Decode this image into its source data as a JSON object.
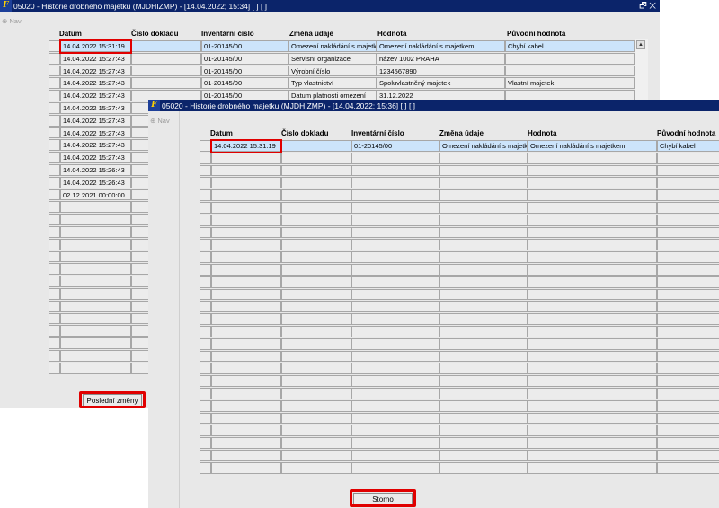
{
  "window1": {
    "title": "05020 - Historie drobného majetku (MJDHIZMP) - [14.04.2022; 15:34]  [ ]  [ ]",
    "window_controls": "🗗 ✕",
    "nav_label": "Nav",
    "headers": [
      "Datum",
      "Číslo dokladu",
      "Inventární číslo",
      "Změna údaje",
      "Hodnota",
      "Původní hodnota"
    ],
    "rows": [
      [
        "14.04.2022 15:31:19",
        "",
        "01-20145/00",
        "Omezení nakládání s majetk",
        "Omezení nakládání s majetkem",
        "Chybí kabel"
      ],
      [
        "14.04.2022 15:27:43",
        "",
        "01-20145/00",
        "Servisní organizace",
        "název 1002  PRAHA",
        ""
      ],
      [
        "14.04.2022 15:27:43",
        "",
        "01-20145/00",
        "Výrobní číslo",
        "1234567890",
        ""
      ],
      [
        "14.04.2022 15:27:43",
        "",
        "01-20145/00",
        "Typ vlastnictví",
        "Spoluvlastněný majetek",
        "Vlastní majetek"
      ],
      [
        "14.04.2022 15:27:43",
        "",
        "01-20145/00",
        "Datum platnosti omezení",
        "31.12.2022",
        ""
      ],
      [
        "14.04.2022 15:27:43",
        "",
        "",
        "",
        "",
        ""
      ],
      [
        "14.04.2022 15:27:43",
        "",
        "",
        "",
        "",
        ""
      ],
      [
        "14.04.2022 15:27:43",
        "",
        "",
        "",
        "",
        ""
      ],
      [
        "14.04.2022 15:27:43",
        "",
        "",
        "",
        "",
        ""
      ],
      [
        "14.04.2022 15:27:43",
        "",
        "",
        "",
        "",
        ""
      ],
      [
        "14.04.2022 15:26:43",
        "",
        "",
        "",
        "",
        ""
      ],
      [
        "14.04.2022 15:26:43",
        "",
        "",
        "",
        "",
        ""
      ],
      [
        "02.12.2021 00:00:00",
        "",
        "",
        "",
        "",
        ""
      ],
      [
        "",
        "",
        "",
        "",
        "",
        ""
      ],
      [
        "",
        "",
        "",
        "",
        "",
        ""
      ],
      [
        "",
        "",
        "",
        "",
        "",
        ""
      ],
      [
        "",
        "",
        "",
        "",
        "",
        ""
      ],
      [
        "",
        "",
        "",
        "",
        "",
        ""
      ],
      [
        "",
        "",
        "",
        "",
        "",
        ""
      ],
      [
        "",
        "",
        "",
        "",
        "",
        ""
      ],
      [
        "",
        "",
        "",
        "",
        "",
        ""
      ],
      [
        "",
        "",
        "",
        "",
        "",
        ""
      ],
      [
        "",
        "",
        "",
        "",
        "",
        ""
      ],
      [
        "",
        "",
        "",
        "",
        "",
        ""
      ],
      [
        "",
        "",
        "",
        "",
        "",
        ""
      ],
      [
        "",
        "",
        "",
        "",
        "",
        ""
      ],
      [
        "",
        "",
        "",
        "",
        "",
        ""
      ]
    ],
    "button_label": "Poslední změny"
  },
  "window2": {
    "title": "05020 - Historie drobného majetku (MJDHIZMP) - [14.04.2022; 15:36]  [ ]  [ ]",
    "nav_label": "Nav",
    "headers": [
      "Datum",
      "Číslo dokladu",
      "Inventární číslo",
      "Změna údaje",
      "Hodnota",
      "Původní hodnota"
    ],
    "rows": [
      [
        "14.04.2022 15:31:19",
        "",
        "01-20145/00",
        "Omezení nakládání s majetk",
        "Omezení nakládání s majetkem",
        "Chybí kabel"
      ],
      [
        "",
        "",
        "",
        "",
        "",
        ""
      ],
      [
        "",
        "",
        "",
        "",
        "",
        ""
      ],
      [
        "",
        "",
        "",
        "",
        "",
        ""
      ],
      [
        "",
        "",
        "",
        "",
        "",
        ""
      ],
      [
        "",
        "",
        "",
        "",
        "",
        ""
      ],
      [
        "",
        "",
        "",
        "",
        "",
        ""
      ],
      [
        "",
        "",
        "",
        "",
        "",
        ""
      ],
      [
        "",
        "",
        "",
        "",
        "",
        ""
      ],
      [
        "",
        "",
        "",
        "",
        "",
        ""
      ],
      [
        "",
        "",
        "",
        "",
        "",
        ""
      ],
      [
        "",
        "",
        "",
        "",
        "",
        ""
      ],
      [
        "",
        "",
        "",
        "",
        "",
        ""
      ],
      [
        "",
        "",
        "",
        "",
        "",
        ""
      ],
      [
        "",
        "",
        "",
        "",
        "",
        ""
      ],
      [
        "",
        "",
        "",
        "",
        "",
        ""
      ],
      [
        "",
        "",
        "",
        "",
        "",
        ""
      ],
      [
        "",
        "",
        "",
        "",
        "",
        ""
      ],
      [
        "",
        "",
        "",
        "",
        "",
        ""
      ],
      [
        "",
        "",
        "",
        "",
        "",
        ""
      ],
      [
        "",
        "",
        "",
        "",
        "",
        ""
      ],
      [
        "",
        "",
        "",
        "",
        "",
        ""
      ],
      [
        "",
        "",
        "",
        "",
        "",
        ""
      ],
      [
        "",
        "",
        "",
        "",
        "",
        ""
      ],
      [
        "",
        "",
        "",
        "",
        "",
        ""
      ],
      [
        "",
        "",
        "",
        "",
        "",
        ""
      ],
      [
        "",
        "",
        "",
        "",
        "",
        ""
      ]
    ],
    "button_label": "Storno"
  },
  "colors": {
    "titlebar": "#0b246a",
    "selected_row": "#cce4fb",
    "highlight": "#e00000"
  }
}
